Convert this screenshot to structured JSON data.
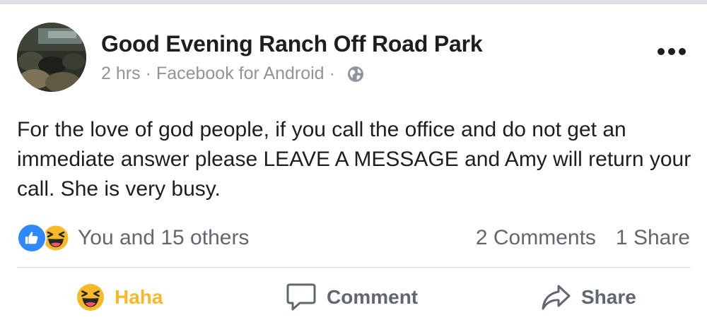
{
  "post": {
    "page_name": "Good Evening Ranch Off Road Park",
    "time": "2 hrs",
    "separator": "·",
    "source": "Facebook for Android",
    "privacy_icon": "globe-icon",
    "body": "For the love of god people, if you call the office and do not get an immediate answer please LEAVE A MESSAGE and Amy will return your call. She is very busy."
  },
  "reactions": {
    "icons": [
      "like-icon",
      "haha-icon"
    ],
    "text": "You and 15 others",
    "comments": "2 Comments",
    "shares": "1 Share"
  },
  "actions": {
    "haha_label": "Haha",
    "comment_label": "Comment",
    "share_label": "Share"
  },
  "colors": {
    "like_blue": "#2e89ff",
    "haha_yellow": "#f7b928",
    "text_primary": "#1c1e21",
    "text_secondary": "#606770",
    "meta_gray": "#90949c"
  }
}
